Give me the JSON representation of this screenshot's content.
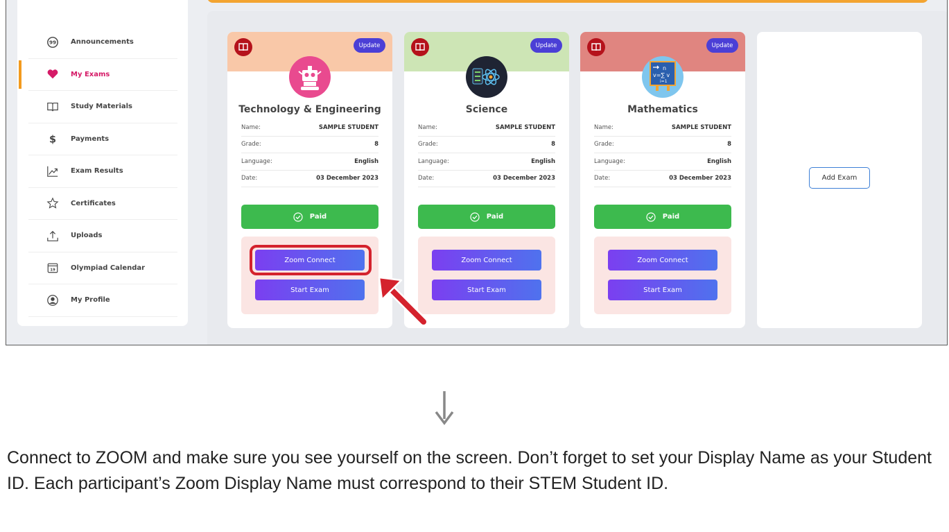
{
  "sidebar": {
    "items": [
      {
        "label": "Announcements",
        "icon": "announcement-icon",
        "active": false
      },
      {
        "label": "My Exams",
        "icon": "heart-icon",
        "active": true
      },
      {
        "label": "Study Materials",
        "icon": "book-icon",
        "active": false
      },
      {
        "label": "Payments",
        "icon": "dollar-icon",
        "active": false
      },
      {
        "label": "Exam Results",
        "icon": "chart-icon",
        "active": false
      },
      {
        "label": "Certificates",
        "icon": "star-icon",
        "active": false
      },
      {
        "label": "Uploads",
        "icon": "upload-icon",
        "active": false
      },
      {
        "label": "Olympiad Calendar",
        "icon": "calendar-icon",
        "active": false
      },
      {
        "label": "My Profile",
        "icon": "profile-icon",
        "active": false
      }
    ],
    "calendar_day": "19",
    "active_color": "#d51a67",
    "active_indicator_color": "#f39a1e"
  },
  "cards": [
    {
      "title": "Technology & Engineering",
      "icon": "robot-icon",
      "header_color": "#f9c8a8",
      "update_label": "Update",
      "name_label": "Name:",
      "name_value": "SAMPLE STUDENT",
      "grade_label": "Grade:",
      "grade_value": "8",
      "language_label": "Language:",
      "language_value": "English",
      "date_label": "Date:",
      "date_value": "03 December 2023",
      "paid_label": "Paid",
      "zoom_label": "Zoom Connect",
      "start_label": "Start Exam"
    },
    {
      "title": "Science",
      "icon": "atom-icon",
      "header_color": "#cde5b5",
      "update_label": "Update",
      "name_label": "Name:",
      "name_value": "SAMPLE STUDENT",
      "grade_label": "Grade:",
      "grade_value": "8",
      "language_label": "Language:",
      "language_value": "English",
      "date_label": "Date:",
      "date_value": "03 December 2023",
      "paid_label": "Paid",
      "zoom_label": "Zoom Connect",
      "start_label": "Start Exam"
    },
    {
      "title": "Mathematics",
      "icon": "math-board-icon",
      "header_color": "#e08580",
      "update_label": "Update",
      "name_label": "Name:",
      "name_value": "SAMPLE STUDENT",
      "grade_label": "Grade:",
      "grade_value": "8",
      "language_label": "Language:",
      "language_value": "English",
      "date_label": "Date:",
      "date_value": "03 December 2023",
      "paid_label": "Paid",
      "zoom_label": "Zoom Connect",
      "start_label": "Start Exam"
    }
  ],
  "add_exam_label": "Add Exam",
  "colors": {
    "paid": "#3dba4e",
    "update": "#4b3fd6",
    "highlight": "#d4222d",
    "top_bar": "#f3a431"
  },
  "caption": "Connect to ZOOM and make sure you see yourself on the screen. Don’t forget to set your Display Name as your Student ID. Each participant’s Zoom Display Name must correspond to their STEM Student ID."
}
